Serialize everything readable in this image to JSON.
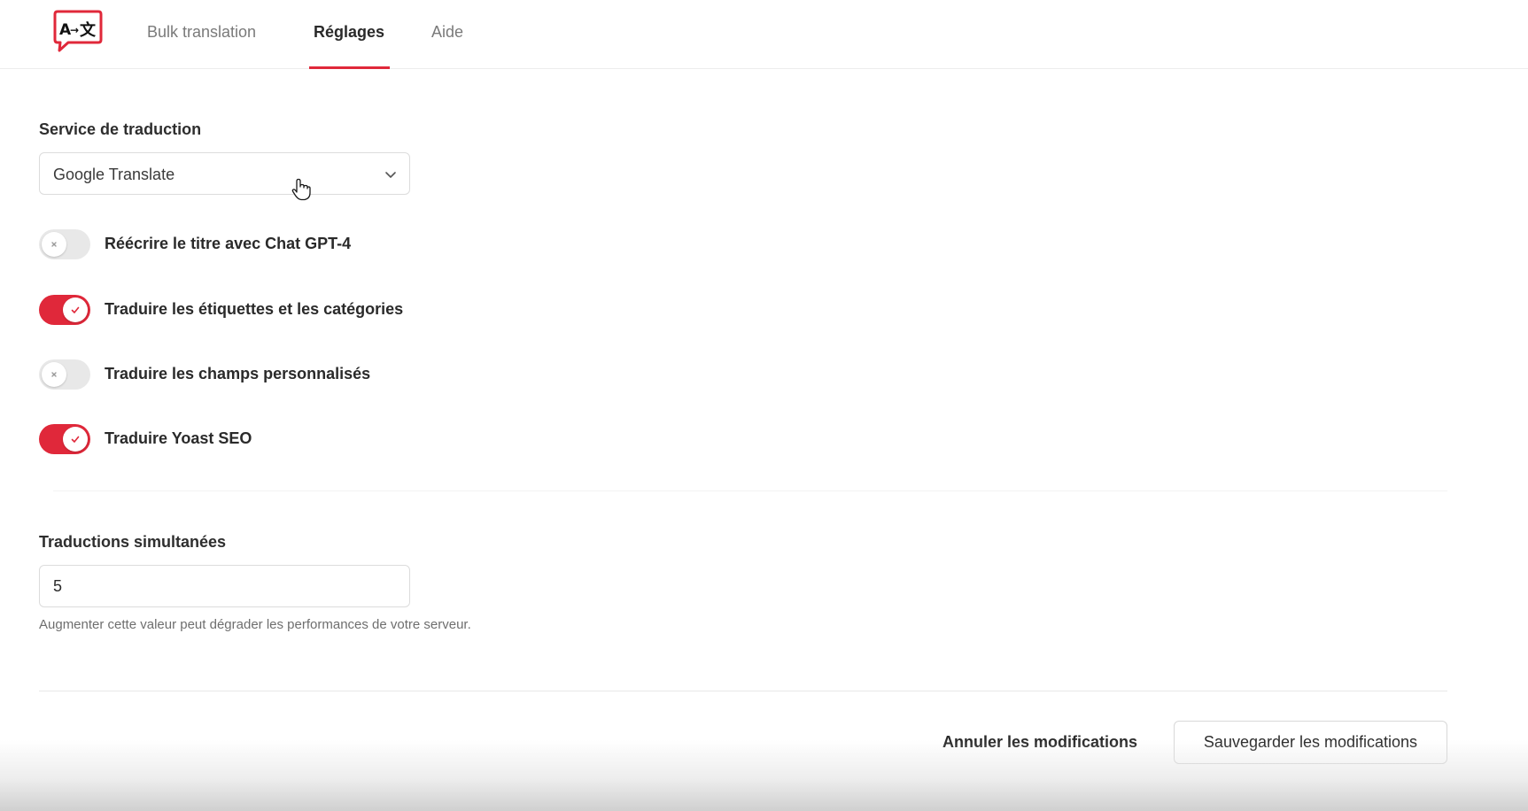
{
  "app": {
    "logo_icon": "translate-logo-icon",
    "accent_color": "#e0283a"
  },
  "nav": {
    "tabs": [
      {
        "label": "Bulk translation",
        "active": false
      },
      {
        "label": "Réglages",
        "active": true
      },
      {
        "label": "Aide",
        "active": false
      }
    ]
  },
  "settings": {
    "service": {
      "label": "Service de traduction",
      "selected": "Google Translate",
      "icon": "chevron-down-icon"
    },
    "toggles": [
      {
        "label": "Réécrire le titre avec Chat GPT-4",
        "on": false
      },
      {
        "label": "Traduire les étiquettes et les catégories",
        "on": true
      },
      {
        "label": "Traduire les champs personnalisés",
        "on": false
      },
      {
        "label": "Traduire Yoast SEO",
        "on": true
      }
    ],
    "simultaneous": {
      "label": "Traductions simultanées",
      "value": "5",
      "help": "Augmenter cette valeur peut dégrader les performances de votre serveur."
    }
  },
  "actions": {
    "cancel_label": "Annuler les modifications",
    "save_label": "Sauvegarder les modifications"
  }
}
